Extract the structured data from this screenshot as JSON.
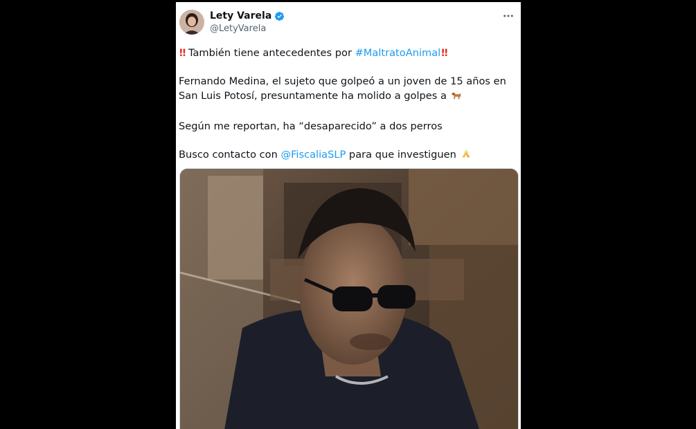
{
  "author": {
    "name": "Lety Varela",
    "handle": "@LetyVarela"
  },
  "tweet": {
    "line1_pre": "También tiene antecedentes por ",
    "line1_hashtag": "#MaltratoAnimal",
    "para2": "Fernando Medina, el sujeto que golpeó a un joven de 15 años en San Luis Potosí, presuntamente ha molido a golpes a ",
    "para3": "Según me reportan, ha “desaparecido” a dos perros",
    "para4_pre": "Busco contacto con ",
    "para4_mention": "@FiscaliaSLP",
    "para4_post": " para que investiguen "
  },
  "icons": {
    "verified": "verified-badge-icon",
    "more": "more-options-icon",
    "double_exclamation": "double-exclamation-icon",
    "dog": "dog-icon",
    "pray": "folded-hands-icon"
  },
  "colors": {
    "link": "#1d9bf0",
    "text": "#0f1419",
    "secondary": "#536471",
    "verified": "#1d9bf0"
  }
}
